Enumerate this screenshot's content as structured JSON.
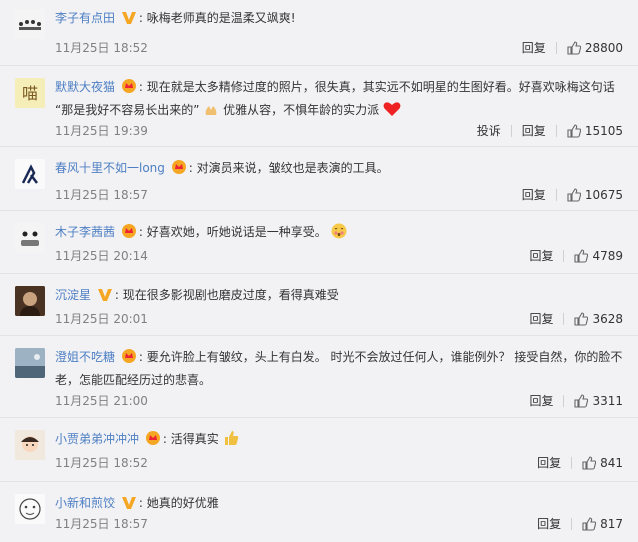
{
  "labels": {
    "reply": "回复",
    "report": "投诉"
  },
  "comments": [
    {
      "user": "李子有点田",
      "badge": "v",
      "text": "咏梅老师真的是温柔又飒爽!",
      "time": "11月25日 18:52",
      "likes": "28800"
    },
    {
      "user": "默默大夜猫",
      "badge": "crown",
      "text1": "现在就是太多精修过度的照片，很失真，其实远不如明星的生图好看。好喜欢咏梅这句话",
      "text2a": "“那是我好不容易长出来的”",
      "text2b": "优雅从容，不惧年龄的实力派",
      "time": "11月25日 19:39",
      "likes": "15105"
    },
    {
      "user": "春风十里不如一long",
      "badge": "crown",
      "text": "对演员来说，皱纹也是表演的工具。",
      "time": "11月25日 18:57",
      "likes": "10675"
    },
    {
      "user": "木子李茜茜",
      "badge": "crown",
      "text": "好喜欢她，听她说话是一种享受。",
      "time": "11月25日 20:14",
      "likes": "4789"
    },
    {
      "user": "沉淀星",
      "badge": "v",
      "text": "现在很多影视剧也磨皮过度，看得真难受",
      "time": "11月25日 20:01",
      "likes": "3628"
    },
    {
      "user": "澄姐不吃糖",
      "badge": "crown",
      "text1": "要允许脸上有皱纹，头上有白发。 时光不会放过任何人，谁能例外？ 接受自然，你的脸不",
      "text2": "老，怎能匹配经历过的悲喜。",
      "time": "11月25日 21:00",
      "likes": "3311"
    },
    {
      "user": "小贾弟弟冲冲冲",
      "badge": "crown",
      "text": "活得真实",
      "time": "11月25日 18:52",
      "likes": "841"
    },
    {
      "user": "小新和煎饺",
      "badge": "v",
      "text": "她真的好优雅",
      "time": "11月25日 18:57",
      "likes": "817"
    }
  ]
}
